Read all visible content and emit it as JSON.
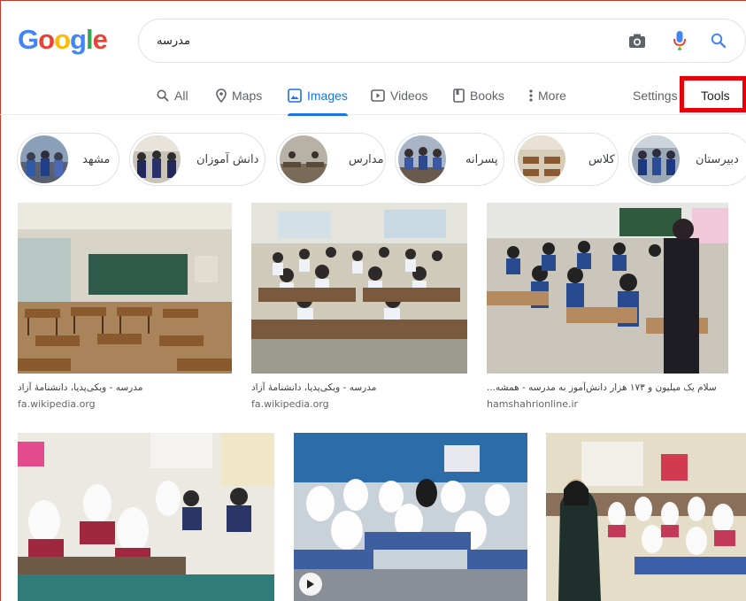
{
  "logo": {
    "text": "Google",
    "letters": [
      "G",
      "o",
      "o",
      "g",
      "l",
      "e"
    ]
  },
  "search": {
    "query": "مدرسه"
  },
  "tabs": [
    {
      "label": "All",
      "icon": "search-icon"
    },
    {
      "label": "Maps",
      "icon": "map-pin-icon"
    },
    {
      "label": "Images",
      "icon": "image-icon",
      "active": true
    },
    {
      "label": "Videos",
      "icon": "play-icon"
    },
    {
      "label": "Books",
      "icon": "book-icon"
    },
    {
      "label": "More",
      "icon": "more-vert-icon"
    }
  ],
  "settings_label": "Settings",
  "tools_label": "Tools",
  "chips": [
    {
      "label": "مشهد"
    },
    {
      "label": "دانش آموزان"
    },
    {
      "label": "مدارس"
    },
    {
      "label": "پسرانه"
    },
    {
      "label": "کلاس"
    },
    {
      "label": "دبیرستان"
    }
  ],
  "results": [
    {
      "caption": "مدرسه - ویکی‌پدیا، دانشنامهٔ آزاد",
      "source": "fa.wikipedia.org"
    },
    {
      "caption": "مدرسه - ویکی‌پدیا، دانشنامهٔ آزاد",
      "source": "fa.wikipedia.org"
    },
    {
      "caption": "سلام یک میلیون و ۱۷۳ هزار دانش‌آموز به مدرسه - همشه...",
      "source": "hamshahrionline.ir"
    },
    {
      "caption": "",
      "source": ""
    },
    {
      "caption": "",
      "source": ""
    },
    {
      "caption": "",
      "source": ""
    }
  ],
  "colors": {
    "accent": "#1a73e8",
    "highlight": "#e8000b",
    "mic": "#4285f4"
  }
}
